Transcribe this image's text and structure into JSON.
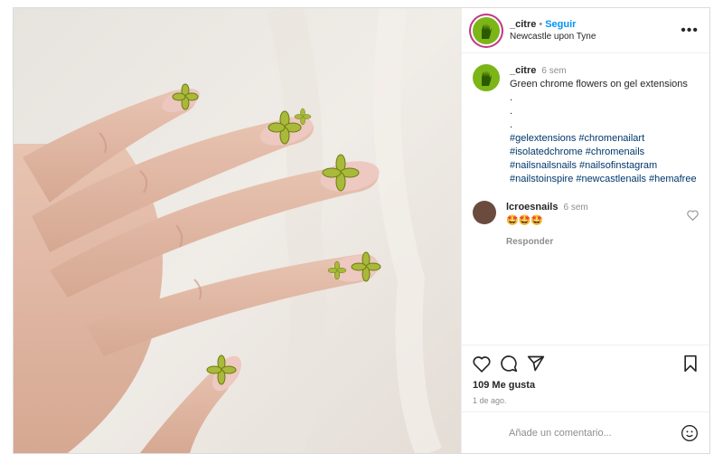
{
  "post": {
    "username": "_citre",
    "follow_label": "Seguir",
    "location": "Newcastle upon Tyne",
    "more_label": "•••",
    "caption": {
      "username": "_citre",
      "time": "6 sem",
      "text": "Green chrome flowers on gel extensions",
      "dot_lines": [
        ".",
        ".",
        "."
      ],
      "hashtags": [
        "#gelextensions",
        "#chromenailart",
        "#isolatedchrome",
        "#chromenails",
        "#nailsnailsnails",
        "#nailsofinstagram",
        "#nailstoinspire",
        "#newcastlenails",
        "#hemafree"
      ]
    },
    "comment": {
      "username": "lcroesnails",
      "time": "6 sem",
      "text": "🤩🤩🤩",
      "reply_label": "Responder"
    },
    "likes": "109 Me gusta",
    "date": "1 de ago.",
    "add_comment_placeholder": "Añade un comentario...",
    "icons": [
      "heart-icon",
      "comment-icon",
      "share-icon",
      "bookmark-icon",
      "emoji-icon",
      "more-icon"
    ],
    "colors": {
      "accent": "#0095f6",
      "hashtag": "#00376b",
      "avatar_green": "#7cb518",
      "ring": "#c13584"
    }
  }
}
